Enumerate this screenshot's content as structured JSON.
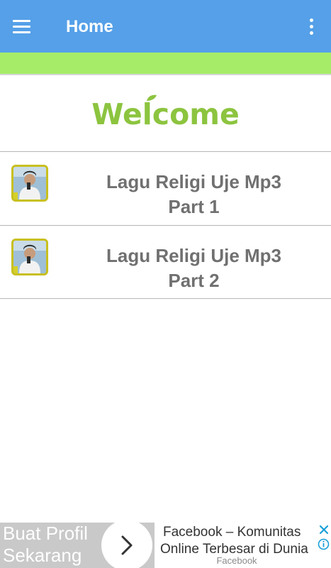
{
  "toolbar": {
    "title": "Home",
    "background_color": "#55a0e8",
    "menu_icon": "hamburger-menu-icon",
    "overflow_icon": "more-vert-icon"
  },
  "accent": {
    "green_bar_color": "#a6ec69",
    "welcome_color": "#8cc43f"
  },
  "welcome": {
    "text": "Welcome"
  },
  "list": {
    "items": [
      {
        "line1": "Lagu Religi Uje Mp3",
        "line2": "Part 1",
        "icon": "singer-thumbnail-icon"
      },
      {
        "line1": "Lagu Religi Uje Mp3",
        "line2": "Part 2",
        "icon": "singer-thumbnail-icon"
      }
    ]
  },
  "ad": {
    "left_line1": "Buat Profil",
    "left_line2": "Sekarang",
    "title_line1": "Facebook – Komunitas",
    "title_line2": "Online Terbesar di Dunia",
    "source": "Facebook",
    "arrow_icon": "chevron-right-icon",
    "close_icon": "close-icon",
    "info_icon": "info-icon"
  }
}
